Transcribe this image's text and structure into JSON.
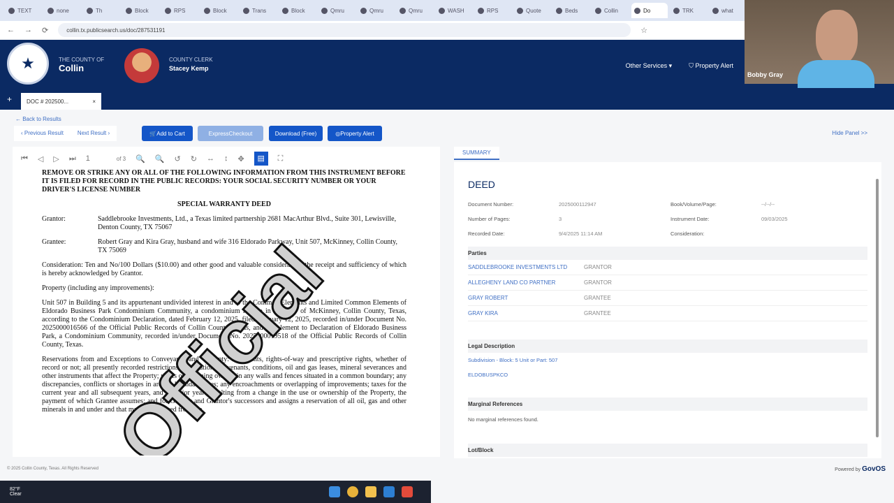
{
  "browser": {
    "tabs": [
      "TEXT",
      "none",
      "Th",
      "Block",
      "RPS",
      "Block",
      "Trans",
      "Block",
      "Qmru",
      "Qmru",
      "Qmru",
      "WASH",
      "RPS",
      "Quote",
      "Beds",
      "Collin",
      "Do",
      "TRK",
      "what"
    ],
    "url": "collin.tx.publicsearch.us/doc/287531191"
  },
  "header": {
    "county_label": "THE COUNTY OF",
    "county_name": "Collin",
    "clerk_label": "COUNTY CLERK",
    "clerk_name": "Stacey Kemp",
    "other_services": "Other Services ▾",
    "property_alert": "Property Alert"
  },
  "webcam": {
    "name": "Bobby Gray"
  },
  "doc_tab": {
    "label": "DOC # 202500...",
    "close": "×",
    "add": "+"
  },
  "actions": {
    "back": "← Back to Results",
    "prev": "‹ Previous Result",
    "next": "Next Result ›",
    "add_cart": "Add to Cart",
    "express": "ExpressCheckout",
    "download": "Download (Free)",
    "alert": "Property Alert",
    "hide": "Hide Panel >>"
  },
  "viewer": {
    "page": "1",
    "of": "of 3"
  },
  "document": {
    "notice": "REMOVE OR STRIKE ANY OR ALL OF THE FOLLOWING INFORMATION FROM THIS INSTRUMENT BEFORE IT IS FILED FOR RECORD IN THE PUBLIC RECORDS: YOUR SOCIAL SECURITY NUMBER OR YOUR DRIVER'S LICENSE NUMBER",
    "title": "SPECIAL WARRANTY DEED",
    "grantor_label": "Grantor:",
    "grantor": "Saddlebrooke Investments, Ltd., a Texas limited partnership 2681 MacArthur Blvd., Suite 301, Lewisville, Denton County, TX 75067",
    "grantee_label": "Grantee:",
    "grantee": "Robert Gray and Kira Gray, husband and wife 316 Eldorado Parkway, Unit 507, McKinney, Collin County, TX 75069",
    "consideration": "Consideration: Ten and No/100 Dollars ($10.00) and other good and valuable consideration, the receipt and sufficiency of which is hereby acknowledged by Grantor.",
    "property_label": "Property (including any improvements):",
    "property": "Unit 507 in Building 5 and its appurtenant undivided interest in and to the Common Elements and Limited Common Elements of Eldorado Business Park Condominium Community, a condominium regime in the City of McKinney, Collin County, Texas, according to the Condominium Declaration, dated February 12, 2025, filed February 12, 2025, recorded in/under Document No. 2025000016566 of the Official Public Records of Collin County, Texas, and Supplement to Declaration of Eldorado Business Park, a Condominium Community, recorded in/under Document No. 2025000019518 of the Official Public Records of Collin County, Texas.",
    "reservations": "Reservations from and Exceptions to Conveyance and Warranty: Easements, rights-of-way and prescriptive rights, whether of record or not; all presently recorded restrictions, reservations, covenants, conditions, oil and gas leases, mineral severances and other instruments that affect the Property; rights of adjoining owners in any walls and fences situated in a common boundary; any discrepancies, conflicts or shortages in area or boundary lines; any encroachments or overlapping of improvements; taxes for the current year and all subsequent years, and for prior years resulting from a change in the use or ownership of the Property, the payment of which Grantee assumes; and for Grantor and Grantor's successors and assigns a reservation of all oil, gas and other minerals in and under and that may be produced from the",
    "watermark": "Official"
  },
  "summary": {
    "tab": "SUMMARY",
    "doc_type": "DEED",
    "fields": [
      [
        "Document Number:",
        "2025000112947",
        "Book/Volume/Page:",
        "--/--/--"
      ],
      [
        "Number of Pages:",
        "3",
        "Instrument Date:",
        "09/03/2025"
      ],
      [
        "Recorded Date:",
        "9/4/2025 11:14 AM",
        "Consideration:",
        ""
      ]
    ],
    "parties_title": "Parties",
    "parties": [
      {
        "name": "SADDLEBROOKE INVESTMENTS LTD",
        "role": "GRANTOR"
      },
      {
        "name": "ALLEGHENY LAND CO PARTNER",
        "role": "GRANTOR"
      },
      {
        "name": "GRAY ROBERT",
        "role": "GRANTEE"
      },
      {
        "name": "GRAY KIRA",
        "role": "GRANTEE"
      }
    ],
    "legal_title": "Legal Description",
    "legal": [
      "Subdivision - Block: 5 Unit or Part: 507",
      "ELDOBUSPKCO"
    ],
    "marginal_title": "Marginal References",
    "marginal": "No marginal references found.",
    "lot_title": "Lot/Block"
  },
  "footer": {
    "copyright": "© 2025 Collin County, Texas. All Rights Reserved",
    "powered": "Powered by",
    "brand": "GovOS"
  },
  "taskbar": {
    "temp": "82°F",
    "cond": "Clear"
  }
}
